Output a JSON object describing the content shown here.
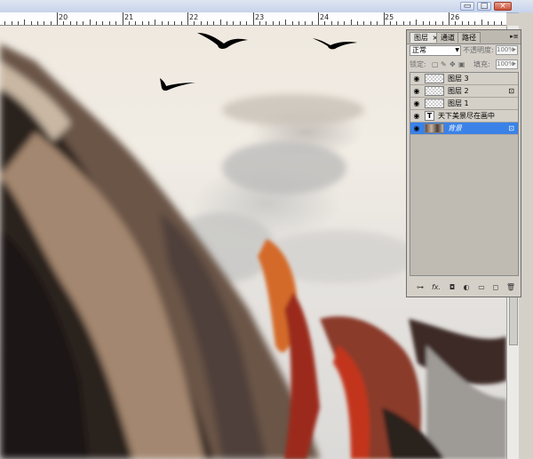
{
  "window": {
    "minimize_glyph": "▭",
    "maximize_glyph": "□",
    "close_glyph": "×"
  },
  "ruler": {
    "ticks": [
      "20",
      "21",
      "22",
      "23",
      "24",
      "25",
      "26"
    ]
  },
  "canvas": {
    "description_icons": [
      "bird-silhouette",
      "bird-silhouette",
      "bird-silhouette"
    ]
  },
  "layers_panel": {
    "tabs": [
      {
        "label": "图层",
        "close": "×"
      },
      {
        "label": "通道"
      },
      {
        "label": "路径"
      }
    ],
    "menu_glyph": "▸≡",
    "blend_mode": "正常",
    "opacity_label": "不透明度:",
    "opacity_value": "100%",
    "lock_label": "锁定:",
    "fill_label": "填充:",
    "fill_value": "100%",
    "layers": [
      {
        "name": "图层 3",
        "type": "pixel",
        "locked": false,
        "selected": false
      },
      {
        "name": "图层 2",
        "type": "pixel",
        "locked": true,
        "selected": false
      },
      {
        "name": "图层 1",
        "type": "pixel",
        "locked": false,
        "selected": false
      },
      {
        "name": "天下美景尽在画中",
        "type": "text",
        "locked": false,
        "selected": false
      },
      {
        "name": "背景",
        "type": "image",
        "locked": true,
        "selected": true
      }
    ],
    "text_layer_glyph": "T",
    "eye_glyph": "👁",
    "lock_glyph": "🔒",
    "footer_icons": [
      "link-layers-icon",
      "fx-icon",
      "mask-icon",
      "adjustment-icon",
      "group-icon",
      "new-layer-icon",
      "delete-layer-icon"
    ],
    "footer_glyphs": [
      "⊶",
      "fx.",
      "◘",
      "◐",
      "▭",
      "◻",
      "🗑"
    ]
  }
}
